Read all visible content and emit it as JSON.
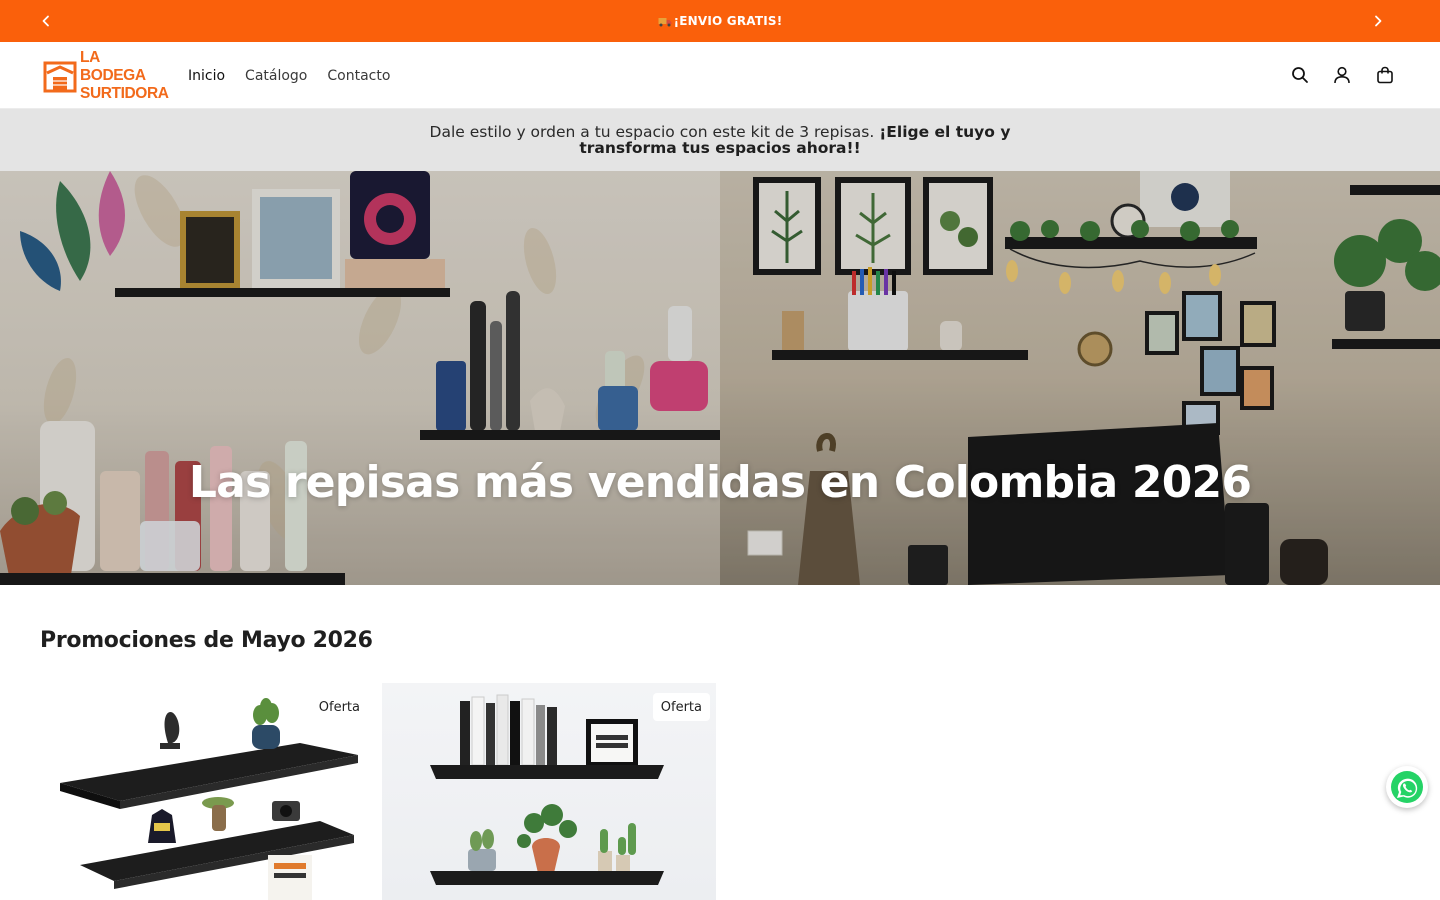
{
  "announcement": {
    "text": "¡ENVIO GRATIS!",
    "truck_icon": "truck-icon",
    "prev_icon": "chevron-left-icon",
    "next_icon": "chevron-right-icon",
    "background": "#fa600b"
  },
  "header": {
    "logo": {
      "line1": "LA BODEGA",
      "line2": "SURTIDORA",
      "color": "#f26a1b"
    },
    "nav": [
      {
        "label": "Inicio"
      },
      {
        "label": "Catálogo"
      },
      {
        "label": "Contacto"
      }
    ],
    "icons": [
      "search-icon",
      "account-icon",
      "cart-icon"
    ]
  },
  "promo_bar": {
    "text_plain": "Dale estilo y orden a tu espacio con este kit de 3 repisas. ",
    "text_bold": "¡Elige el tuyo y transforma tus espacios ahora!!"
  },
  "hero": {
    "heading": "Las repisas más vendidas en Colombia 2026"
  },
  "promotions": {
    "title": "Promociones de Mayo 2026",
    "cards": [
      {
        "badge": "Oferta"
      },
      {
        "badge": "Oferta"
      }
    ]
  },
  "whatsapp": {
    "icon": "whatsapp-icon",
    "color": "#25d366"
  }
}
